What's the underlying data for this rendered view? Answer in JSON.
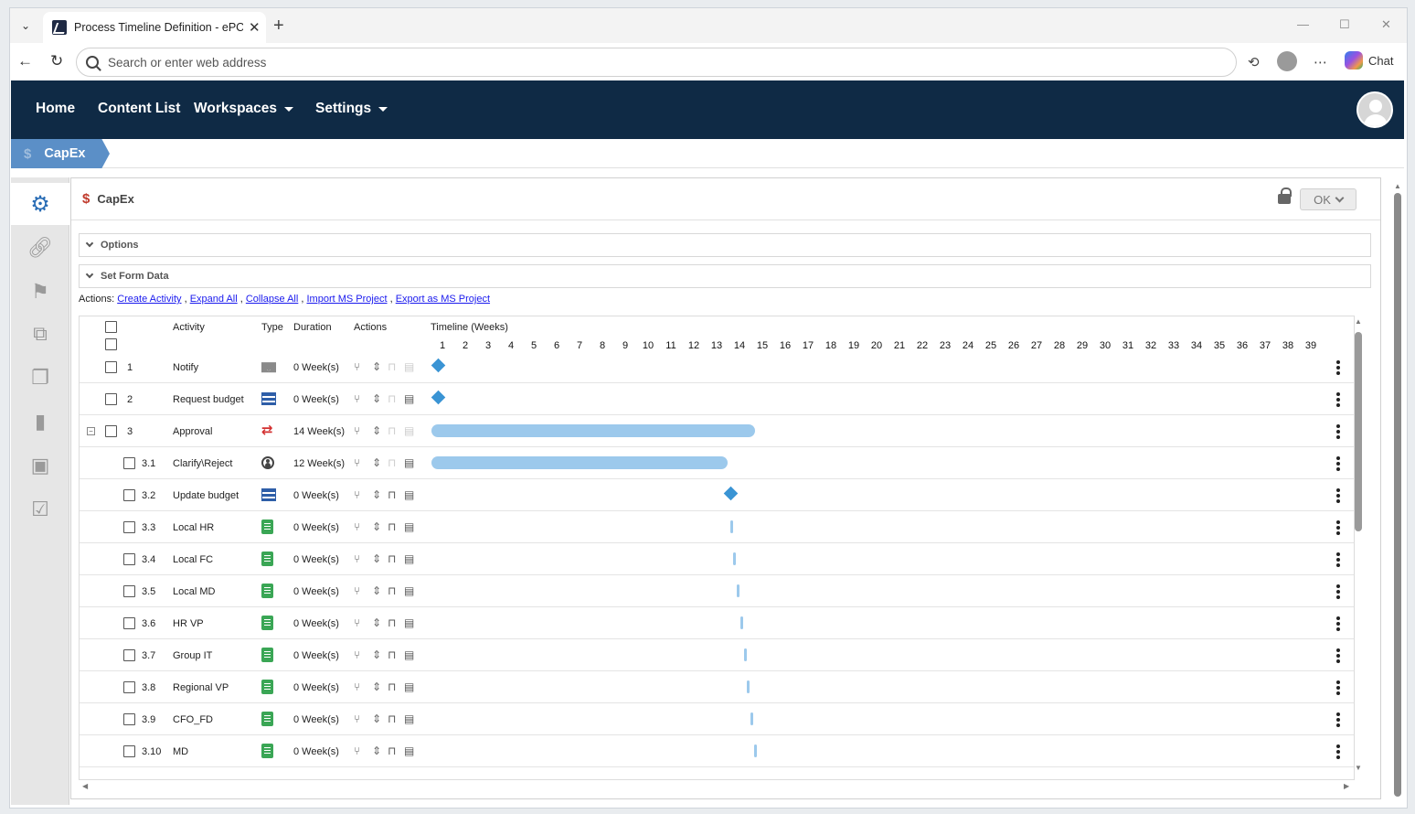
{
  "browser": {
    "tab_title": "Process Timeline Definition - ePC |",
    "url_placeholder": "Search or enter web address",
    "chat_label": "Chat"
  },
  "nav": {
    "home": "Home",
    "content_list": "Content List",
    "workspaces": "Workspaces",
    "settings": "Settings"
  },
  "breadcrumb": {
    "label": "CapEx",
    "icon": "$"
  },
  "form": {
    "title": "CapEx",
    "title_icon": "$",
    "ok_label": "OK",
    "sections": [
      "Options",
      "Set Form Data"
    ],
    "actions_prefix": "Actions:",
    "actions": [
      "Create Activity",
      "Expand All",
      "Collapse All",
      "Import MS Project",
      "Export as MS Project"
    ]
  },
  "grid": {
    "headers": {
      "activity": "Activity",
      "type": "Type",
      "duration": "Duration",
      "actions": "Actions",
      "timeline": "Timeline (Weeks)"
    },
    "weeks": [
      "1",
      "2",
      "3",
      "4",
      "5",
      "6",
      "7",
      "8",
      "9",
      "10",
      "11",
      "12",
      "13",
      "14",
      "15",
      "16",
      "17",
      "18",
      "19",
      "20",
      "21",
      "22",
      "23",
      "24",
      "25",
      "26",
      "27",
      "28",
      "29",
      "30",
      "31",
      "32",
      "33",
      "34",
      "35",
      "36",
      "37",
      "38",
      "39"
    ],
    "rows": [
      {
        "num": "1",
        "name": "Notify",
        "duration": "0 Week(s)",
        "type": "mail",
        "indent": false,
        "expander": false,
        "mark": "milestone",
        "start": 0,
        "length": 0
      },
      {
        "num": "2",
        "name": "Request budget",
        "duration": "0 Week(s)",
        "type": "form",
        "indent": false,
        "expander": false,
        "mark": "milestone",
        "start": 0,
        "length": 0
      },
      {
        "num": "3",
        "name": "Approval",
        "duration": "14 Week(s)",
        "type": "cycle",
        "indent": false,
        "expander": true,
        "mark": "bar",
        "start": 0,
        "length": 14
      },
      {
        "num": "3.1",
        "name": "Clarify\\Reject",
        "duration": "12 Week(s)",
        "type": "user",
        "indent": true,
        "expander": false,
        "mark": "bar",
        "start": 0,
        "length": 12.8
      },
      {
        "num": "3.2",
        "name": "Update budget",
        "duration": "0 Week(s)",
        "type": "form",
        "indent": true,
        "expander": false,
        "mark": "milestone",
        "start": 12.8,
        "length": 0
      },
      {
        "num": "3.3",
        "name": "Local HR",
        "duration": "0 Week(s)",
        "type": "clip",
        "indent": true,
        "expander": false,
        "mark": "tick",
        "start": 12.9,
        "length": 0
      },
      {
        "num": "3.4",
        "name": "Local FC",
        "duration": "0 Week(s)",
        "type": "clip",
        "indent": true,
        "expander": false,
        "mark": "tick",
        "start": 13.05,
        "length": 0
      },
      {
        "num": "3.5",
        "name": "Local MD",
        "duration": "0 Week(s)",
        "type": "clip",
        "indent": true,
        "expander": false,
        "mark": "tick",
        "start": 13.2,
        "length": 0
      },
      {
        "num": "3.6",
        "name": "HR VP",
        "duration": "0 Week(s)",
        "type": "clip",
        "indent": true,
        "expander": false,
        "mark": "tick",
        "start": 13.35,
        "length": 0
      },
      {
        "num": "3.7",
        "name": "Group IT",
        "duration": "0 Week(s)",
        "type": "clip",
        "indent": true,
        "expander": false,
        "mark": "tick",
        "start": 13.5,
        "length": 0
      },
      {
        "num": "3.8",
        "name": "Regional VP",
        "duration": "0 Week(s)",
        "type": "clip",
        "indent": true,
        "expander": false,
        "mark": "tick",
        "start": 13.65,
        "length": 0
      },
      {
        "num": "3.9",
        "name": "CFO_FD",
        "duration": "0 Week(s)",
        "type": "clip",
        "indent": true,
        "expander": false,
        "mark": "tick",
        "start": 13.8,
        "length": 0
      },
      {
        "num": "3.10",
        "name": "MD",
        "duration": "0 Week(s)",
        "type": "clip",
        "indent": true,
        "expander": false,
        "mark": "tick",
        "start": 13.95,
        "length": 0
      }
    ]
  },
  "colors": {
    "nav_bg": "#0f2a45",
    "crumb_bg": "#5b8fc7",
    "bar": "#9cc9ec",
    "milestone": "#3a94d4",
    "link": "#1a1aee"
  }
}
